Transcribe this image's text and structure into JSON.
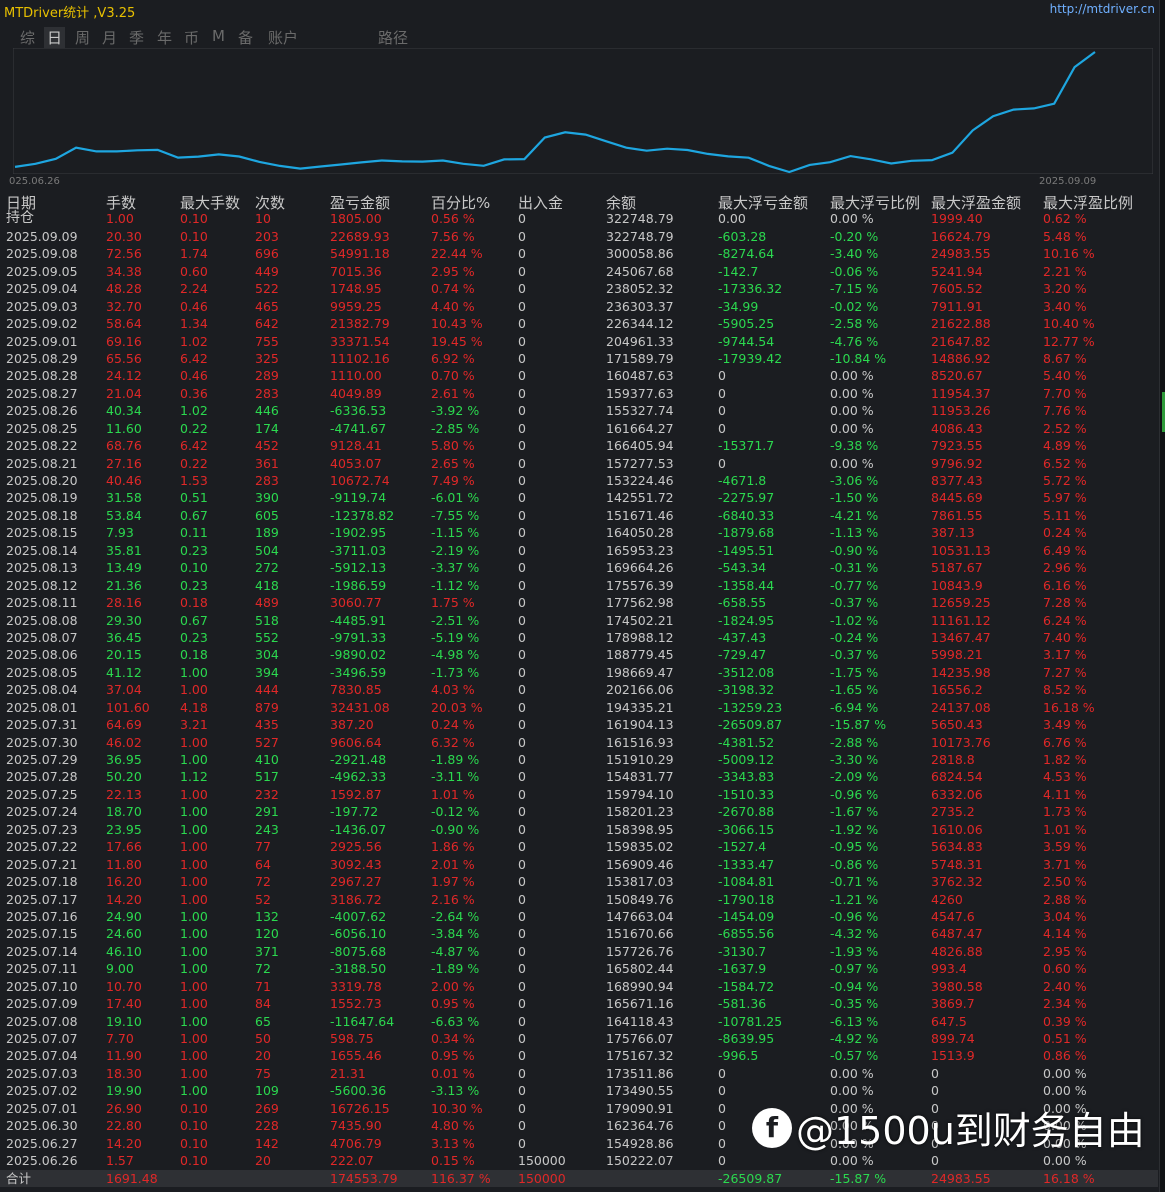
{
  "app_title": "MTDriver统计 ,V3.25",
  "site_link": "http://mtdriver.cn",
  "tabs": [
    {
      "label": "综",
      "active": false
    },
    {
      "label": "日",
      "active": true
    },
    {
      "label": "周",
      "active": false
    },
    {
      "label": "月",
      "active": false
    },
    {
      "label": "季",
      "active": false
    },
    {
      "label": "年",
      "active": false
    },
    {
      "label": "币",
      "active": false
    },
    {
      "label": "M",
      "active": false
    },
    {
      "label": "备",
      "active": false
    },
    {
      "label": "账户",
      "active": false
    },
    {
      "label": "路径",
      "active": false
    }
  ],
  "chart_data": {
    "type": "line",
    "x_start_label": "025.06.26",
    "x_end_label": "2025.09.09",
    "line_color": "#1ea6e0",
    "values": [
      150222.07,
      154928.86,
      162364.76,
      179090.91,
      173490.55,
      173511.86,
      175167.32,
      175766.07,
      164118.43,
      165671.16,
      168990.94,
      165802.44,
      157726.76,
      151670.66,
      147663.04,
      150849.76,
      153817.03,
      156909.46,
      159835.02,
      158398.95,
      158201.23,
      159794.1,
      154831.77,
      151910.29,
      161516.93,
      161904.13,
      194335.21,
      202166.06,
      198669.47,
      188779.45,
      178988.12,
      174502.21,
      177562.98,
      175576.39,
      169664.26,
      165953.23,
      164050.28,
      151671.46,
      142551.72,
      153224.46,
      157277.53,
      166405.94,
      161664.27,
      155327.74,
      159377.63,
      160487.63,
      171589.79,
      204961.33,
      226344.12,
      236303.37,
      238052.32,
      245067.68,
      300058.86,
      322748.79
    ]
  },
  "table": {
    "headers": [
      "日期",
      "手数",
      "最大手数",
      "次数",
      "盈亏金额",
      "百分比%",
      "出入金",
      "余额",
      "最大浮亏金额",
      "最大浮亏比例",
      "最大浮盈金额",
      "最大浮盈比例"
    ],
    "rows": [
      [
        "持仓",
        "1.00",
        "0.10",
        "10",
        "1805.00",
        "0.56 %",
        "0",
        "322748.79",
        "0.00",
        "0.00 %",
        "1999.40",
        "0.62 %"
      ],
      [
        "2025.09.09",
        "20.30",
        "0.10",
        "203",
        "22689.93",
        "7.56 %",
        "0",
        "322748.79",
        "-603.28",
        "-0.20 %",
        "16624.79",
        "5.48 %"
      ],
      [
        "2025.09.08",
        "72.56",
        "1.74",
        "696",
        "54991.18",
        "22.44 %",
        "0",
        "300058.86",
        "-8274.64",
        "-3.40 %",
        "24983.55",
        "10.16 %"
      ],
      [
        "2025.09.05",
        "34.38",
        "0.60",
        "449",
        "7015.36",
        "2.95 %",
        "0",
        "245067.68",
        "-142.7",
        "-0.06 %",
        "5241.94",
        "2.21 %"
      ],
      [
        "2025.09.04",
        "48.28",
        "2.24",
        "522",
        "1748.95",
        "0.74 %",
        "0",
        "238052.32",
        "-17336.32",
        "-7.15 %",
        "7605.52",
        "3.20 %"
      ],
      [
        "2025.09.03",
        "32.70",
        "0.46",
        "465",
        "9959.25",
        "4.40 %",
        "0",
        "236303.37",
        "-34.99",
        "-0.02 %",
        "7911.91",
        "3.40 %"
      ],
      [
        "2025.09.02",
        "58.64",
        "1.34",
        "642",
        "21382.79",
        "10.43 %",
        "0",
        "226344.12",
        "-5905.25",
        "-2.58 %",
        "21622.88",
        "10.40 %"
      ],
      [
        "2025.09.01",
        "69.16",
        "1.02",
        "755",
        "33371.54",
        "19.45 %",
        "0",
        "204961.33",
        "-9744.54",
        "-4.76 %",
        "21647.82",
        "12.77 %"
      ],
      [
        "2025.08.29",
        "65.56",
        "6.42",
        "325",
        "11102.16",
        "6.92 %",
        "0",
        "171589.79",
        "-17939.42",
        "-10.84 %",
        "14886.92",
        "8.67 %"
      ],
      [
        "2025.08.28",
        "24.12",
        "0.46",
        "289",
        "1110.00",
        "0.70 %",
        "0",
        "160487.63",
        "0",
        "0.00 %",
        "8520.67",
        "5.40 %"
      ],
      [
        "2025.08.27",
        "21.04",
        "0.36",
        "283",
        "4049.89",
        "2.61 %",
        "0",
        "159377.63",
        "0",
        "0.00 %",
        "11954.37",
        "7.70 %"
      ],
      [
        "2025.08.26",
        "40.34",
        "1.02",
        "446",
        "-6336.53",
        "-3.92 %",
        "0",
        "155327.74",
        "0",
        "0.00 %",
        "11953.26",
        "7.76 %"
      ],
      [
        "2025.08.25",
        "11.60",
        "0.22",
        "174",
        "-4741.67",
        "-2.85 %",
        "0",
        "161664.27",
        "0",
        "0.00 %",
        "4086.43",
        "2.52 %"
      ],
      [
        "2025.08.22",
        "68.76",
        "6.42",
        "452",
        "9128.41",
        "5.80 %",
        "0",
        "166405.94",
        "-15371.7",
        "-9.38 %",
        "7923.55",
        "4.89 %"
      ],
      [
        "2025.08.21",
        "27.16",
        "0.22",
        "361",
        "4053.07",
        "2.65 %",
        "0",
        "157277.53",
        "0",
        "0.00 %",
        "9796.92",
        "6.52 %"
      ],
      [
        "2025.08.20",
        "40.46",
        "1.53",
        "283",
        "10672.74",
        "7.49 %",
        "0",
        "153224.46",
        "-4671.8",
        "-3.06 %",
        "8377.43",
        "5.72 %"
      ],
      [
        "2025.08.19",
        "31.58",
        "0.51",
        "390",
        "-9119.74",
        "-6.01 %",
        "0",
        "142551.72",
        "-2275.97",
        "-1.50 %",
        "8445.69",
        "5.97 %"
      ],
      [
        "2025.08.18",
        "53.84",
        "0.67",
        "605",
        "-12378.82",
        "-7.55 %",
        "0",
        "151671.46",
        "-6840.33",
        "-4.21 %",
        "7861.55",
        "5.11 %"
      ],
      [
        "2025.08.15",
        "7.93",
        "0.11",
        "189",
        "-1902.95",
        "-1.15 %",
        "0",
        "164050.28",
        "-1879.68",
        "-1.13 %",
        "387.13",
        "0.24 %"
      ],
      [
        "2025.08.14",
        "35.81",
        "0.23",
        "504",
        "-3711.03",
        "-2.19 %",
        "0",
        "165953.23",
        "-1495.51",
        "-0.90 %",
        "10531.13",
        "6.49 %"
      ],
      [
        "2025.08.13",
        "13.49",
        "0.10",
        "272",
        "-5912.13",
        "-3.37 %",
        "0",
        "169664.26",
        "-543.34",
        "-0.31 %",
        "5187.67",
        "2.96 %"
      ],
      [
        "2025.08.12",
        "21.36",
        "0.23",
        "418",
        "-1986.59",
        "-1.12 %",
        "0",
        "175576.39",
        "-1358.44",
        "-0.77 %",
        "10843.9",
        "6.16 %"
      ],
      [
        "2025.08.11",
        "28.16",
        "0.18",
        "489",
        "3060.77",
        "1.75 %",
        "0",
        "177562.98",
        "-658.55",
        "-0.37 %",
        "12659.25",
        "7.28 %"
      ],
      [
        "2025.08.08",
        "29.30",
        "0.67",
        "518",
        "-4485.91",
        "-2.51 %",
        "0",
        "174502.21",
        "-1824.95",
        "-1.02 %",
        "11161.12",
        "6.24 %"
      ],
      [
        "2025.08.07",
        "36.45",
        "0.23",
        "552",
        "-9791.33",
        "-5.19 %",
        "0",
        "178988.12",
        "-437.43",
        "-0.24 %",
        "13467.47",
        "7.40 %"
      ],
      [
        "2025.08.06",
        "20.15",
        "0.18",
        "304",
        "-9890.02",
        "-4.98 %",
        "0",
        "188779.45",
        "-729.47",
        "-0.37 %",
        "5998.21",
        "3.17 %"
      ],
      [
        "2025.08.05",
        "41.12",
        "1.00",
        "394",
        "-3496.59",
        "-1.73 %",
        "0",
        "198669.47",
        "-3512.08",
        "-1.75 %",
        "14235.98",
        "7.27 %"
      ],
      [
        "2025.08.04",
        "37.04",
        "1.00",
        "444",
        "7830.85",
        "4.03 %",
        "0",
        "202166.06",
        "-3198.32",
        "-1.65 %",
        "16556.2",
        "8.52 %"
      ],
      [
        "2025.08.01",
        "101.60",
        "4.18",
        "879",
        "32431.08",
        "20.03 %",
        "0",
        "194335.21",
        "-13259.23",
        "-6.94 %",
        "24137.08",
        "16.18 %"
      ],
      [
        "2025.07.31",
        "64.69",
        "3.21",
        "435",
        "387.20",
        "0.24 %",
        "0",
        "161904.13",
        "-26509.87",
        "-15.87 %",
        "5650.43",
        "3.49 %"
      ],
      [
        "2025.07.30",
        "46.02",
        "1.00",
        "527",
        "9606.64",
        "6.32 %",
        "0",
        "161516.93",
        "-4381.52",
        "-2.88 %",
        "10173.76",
        "6.76 %"
      ],
      [
        "2025.07.29",
        "36.95",
        "1.00",
        "410",
        "-2921.48",
        "-1.89 %",
        "0",
        "151910.29",
        "-5009.12",
        "-3.30 %",
        "2818.8",
        "1.82 %"
      ],
      [
        "2025.07.28",
        "50.20",
        "1.12",
        "517",
        "-4962.33",
        "-3.11 %",
        "0",
        "154831.77",
        "-3343.83",
        "-2.09 %",
        "6824.54",
        "4.53 %"
      ],
      [
        "2025.07.25",
        "22.13",
        "1.00",
        "232",
        "1592.87",
        "1.01 %",
        "0",
        "159794.10",
        "-1510.33",
        "-0.96 %",
        "6332.06",
        "4.11 %"
      ],
      [
        "2025.07.24",
        "18.70",
        "1.00",
        "291",
        "-197.72",
        "-0.12 %",
        "0",
        "158201.23",
        "-2670.88",
        "-1.67 %",
        "2735.2",
        "1.73 %"
      ],
      [
        "2025.07.23",
        "23.95",
        "1.00",
        "243",
        "-1436.07",
        "-0.90 %",
        "0",
        "158398.95",
        "-3066.15",
        "-1.92 %",
        "1610.06",
        "1.01 %"
      ],
      [
        "2025.07.22",
        "17.66",
        "1.00",
        "77",
        "2925.56",
        "1.86 %",
        "0",
        "159835.02",
        "-1527.4",
        "-0.95 %",
        "5634.83",
        "3.59 %"
      ],
      [
        "2025.07.21",
        "11.80",
        "1.00",
        "64",
        "3092.43",
        "2.01 %",
        "0",
        "156909.46",
        "-1333.47",
        "-0.86 %",
        "5748.31",
        "3.71 %"
      ],
      [
        "2025.07.18",
        "16.20",
        "1.00",
        "72",
        "2967.27",
        "1.97 %",
        "0",
        "153817.03",
        "-1084.81",
        "-0.71 %",
        "3762.32",
        "2.50 %"
      ],
      [
        "2025.07.17",
        "14.20",
        "1.00",
        "52",
        "3186.72",
        "2.16 %",
        "0",
        "150849.76",
        "-1790.18",
        "-1.21 %",
        "4260",
        "2.88 %"
      ],
      [
        "2025.07.16",
        "24.90",
        "1.00",
        "132",
        "-4007.62",
        "-2.64 %",
        "0",
        "147663.04",
        "-1454.09",
        "-0.96 %",
        "4547.6",
        "3.04 %"
      ],
      [
        "2025.07.15",
        "24.60",
        "1.00",
        "120",
        "-6056.10",
        "-3.84 %",
        "0",
        "151670.66",
        "-6855.56",
        "-4.32 %",
        "6487.47",
        "4.14 %"
      ],
      [
        "2025.07.14",
        "46.10",
        "1.00",
        "371",
        "-8075.68",
        "-4.87 %",
        "0",
        "157726.76",
        "-3130.7",
        "-1.93 %",
        "4826.88",
        "2.95 %"
      ],
      [
        "2025.07.11",
        "9.00",
        "1.00",
        "72",
        "-3188.50",
        "-1.89 %",
        "0",
        "165802.44",
        "-1637.9",
        "-0.97 %",
        "993.4",
        "0.60 %"
      ],
      [
        "2025.07.10",
        "10.70",
        "1.00",
        "71",
        "3319.78",
        "2.00 %",
        "0",
        "168990.94",
        "-1584.72",
        "-0.94 %",
        "3980.58",
        "2.40 %"
      ],
      [
        "2025.07.09",
        "17.40",
        "1.00",
        "84",
        "1552.73",
        "0.95 %",
        "0",
        "165671.16",
        "-581.36",
        "-0.35 %",
        "3869.7",
        "2.34 %"
      ],
      [
        "2025.07.08",
        "19.10",
        "1.00",
        "65",
        "-11647.64",
        "-6.63 %",
        "0",
        "164118.43",
        "-10781.25",
        "-6.13 %",
        "647.5",
        "0.39 %"
      ],
      [
        "2025.07.07",
        "7.70",
        "1.00",
        "50",
        "598.75",
        "0.34 %",
        "0",
        "175766.07",
        "-8639.95",
        "-4.92 %",
        "899.74",
        "0.51 %"
      ],
      [
        "2025.07.04",
        "11.90",
        "1.00",
        "20",
        "1655.46",
        "0.95 %",
        "0",
        "175167.32",
        "-996.5",
        "-0.57 %",
        "1513.9",
        "0.86 %"
      ],
      [
        "2025.07.03",
        "18.30",
        "1.00",
        "75",
        "21.31",
        "0.01 %",
        "0",
        "173511.86",
        "0",
        "0.00 %",
        "0",
        "0.00 %"
      ],
      [
        "2025.07.02",
        "19.90",
        "1.00",
        "109",
        "-5600.36",
        "-3.13 %",
        "0",
        "173490.55",
        "0",
        "0.00 %",
        "0",
        "0.00 %"
      ],
      [
        "2025.07.01",
        "26.90",
        "0.10",
        "269",
        "16726.15",
        "10.30 %",
        "0",
        "179090.91",
        "0",
        "0.00 %",
        "0",
        "0.00 %"
      ],
      [
        "2025.06.30",
        "22.80",
        "0.10",
        "228",
        "7435.90",
        "4.80 %",
        "0",
        "162364.76",
        "0",
        "0.00 %",
        "0",
        "0.00 %"
      ],
      [
        "2025.06.27",
        "14.20",
        "0.10",
        "142",
        "4706.79",
        "3.13 %",
        "0",
        "154928.86",
        "0",
        "0.00 %",
        "0",
        "0.00 %"
      ],
      [
        "2025.06.26",
        "1.57",
        "0.10",
        "20",
        "222.07",
        "0.15 %",
        "150000",
        "150222.07",
        "0",
        "0.00 %",
        "0",
        "0.00 %"
      ]
    ],
    "total": [
      "合计",
      "1691.48",
      "",
      "",
      "174553.79",
      "116.37 %",
      "150000",
      "",
      "-26509.87",
      "-15.87 %",
      "24983.55",
      "16.18 %"
    ]
  },
  "watermark": {
    "icon": "f",
    "text": "@1500u到财务自由"
  }
}
